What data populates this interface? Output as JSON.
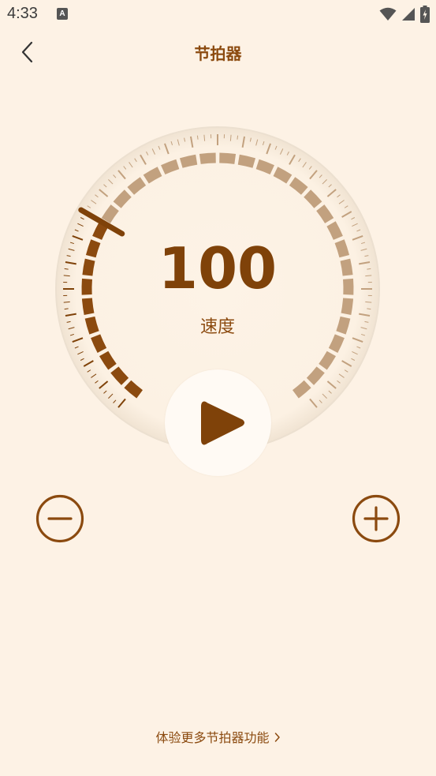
{
  "status": {
    "time": "4:33",
    "notif_icon": "A"
  },
  "header": {
    "title": "节拍器"
  },
  "dial": {
    "tempo": "100",
    "tempo_label": "速度"
  },
  "footer": {
    "more_label": "体验更多节拍器功能"
  },
  "colors": {
    "background": "#fdf2e5",
    "accent": "#7f4209",
    "segment_inactive": "#c2a17f",
    "segment_active": "#8b4a0f"
  },
  "icons": {
    "back": "chevron-left-icon",
    "play": "play-icon",
    "minus": "minus-circle-icon",
    "plus": "plus-circle-icon",
    "more": "chevron-right-icon"
  }
}
